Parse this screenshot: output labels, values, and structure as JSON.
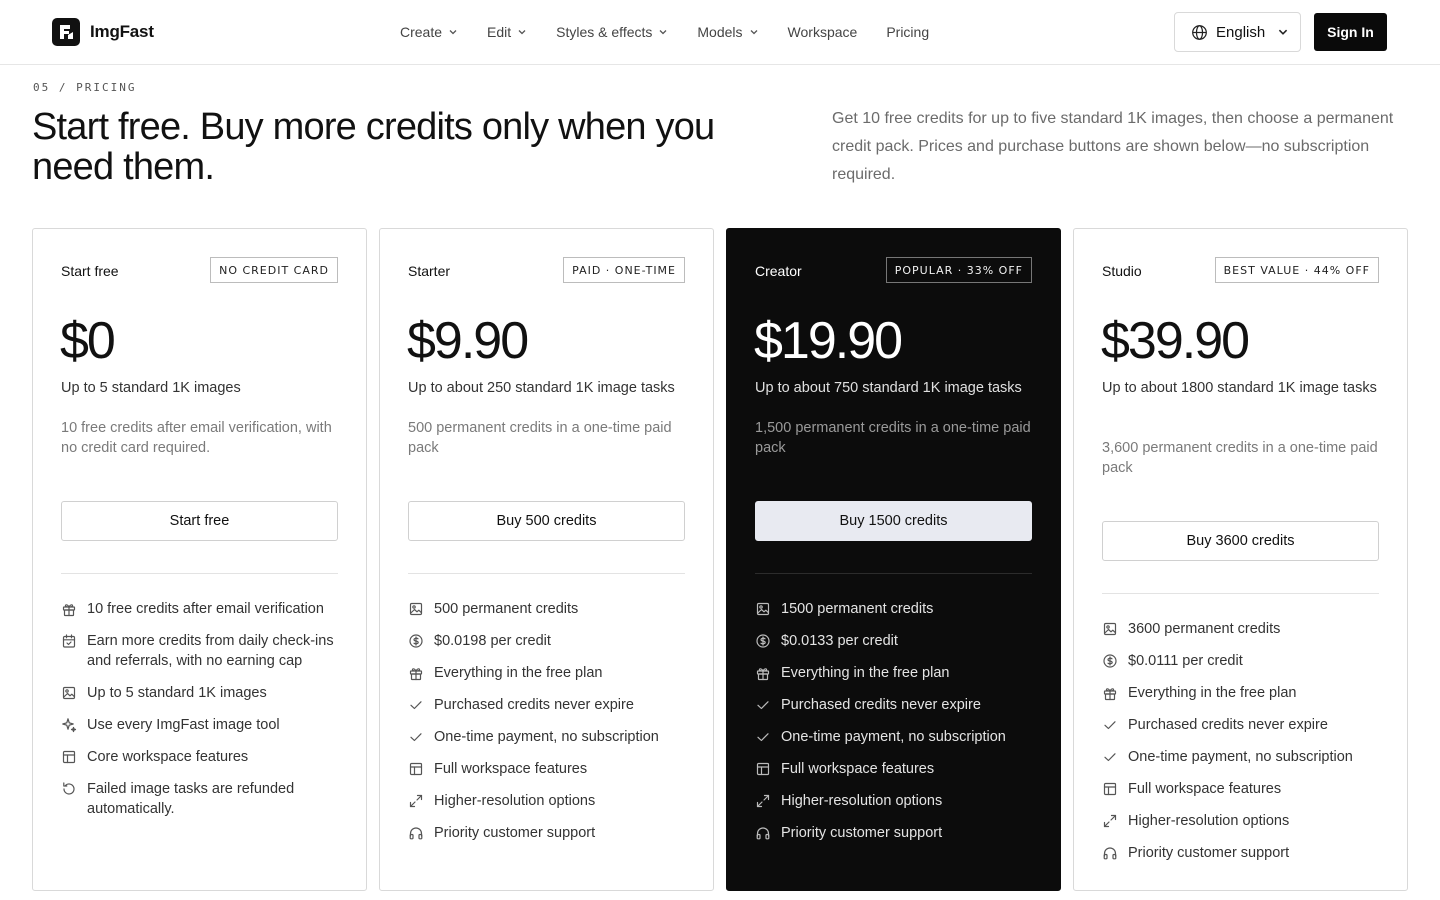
{
  "brand": {
    "name": "ImgFast"
  },
  "nav": [
    {
      "label": "Create",
      "dropdown": true,
      "icon": "chevron-down-icon"
    },
    {
      "label": "Edit",
      "dropdown": true,
      "icon": "chevron-down-icon"
    },
    {
      "label": "Styles & effects",
      "dropdown": true,
      "icon": "chevron-down-icon"
    },
    {
      "label": "Models",
      "dropdown": true,
      "icon": "chevron-down-icon"
    },
    {
      "label": "Workspace",
      "dropdown": false
    },
    {
      "label": "Pricing",
      "dropdown": false
    }
  ],
  "language": {
    "label": "English",
    "icon": "globe-icon"
  },
  "signin": {
    "label": "Sign In"
  },
  "hero": {
    "eyebrow": "05 / PRICING",
    "headline": "Start free. Buy more credits only when you need them.",
    "lede": "Get 10 free credits for up to five standard 1K images, then choose a permanent credit pack. Prices and purchase buttons are shown below—no subscription required."
  },
  "plans": [
    {
      "name": "Start free",
      "badge": "NO CREDIT CARD",
      "price": "$0",
      "summary": "Up to 5 standard 1K images",
      "description": "10 free credits after email verification, with no credit card required.",
      "cta": "Start free",
      "dark": false,
      "features": [
        {
          "icon": "gift-icon",
          "text": "10 free credits after email verification"
        },
        {
          "icon": "calendar-icon",
          "text": "Earn more credits from daily check-ins and referrals, with no earning cap"
        },
        {
          "icon": "image-icon",
          "text": "Up to 5 standard 1K images"
        },
        {
          "icon": "sparkles-icon",
          "text": "Use every ImgFast image tool"
        },
        {
          "icon": "layout-icon",
          "text": "Core workspace features"
        },
        {
          "icon": "refresh-icon",
          "text": "Failed image tasks are refunded automatically."
        }
      ]
    },
    {
      "name": "Starter",
      "badge": "PAID · ONE-TIME",
      "price": "$9.90",
      "summary": "Up to about 250 standard 1K image tasks",
      "description": "500 permanent credits in a one-time paid pack",
      "cta": "Buy 500 credits",
      "dark": false,
      "features": [
        {
          "icon": "image-icon",
          "text": "500 permanent credits"
        },
        {
          "icon": "dollar-icon",
          "text": "$0.0198 per credit"
        },
        {
          "icon": "gift-icon",
          "text": "Everything in the free plan"
        },
        {
          "icon": "check-icon",
          "text": "Purchased credits never expire"
        },
        {
          "icon": "check-icon",
          "text": "One-time payment, no subscription"
        },
        {
          "icon": "layout-icon",
          "text": "Full workspace features"
        },
        {
          "icon": "expand-icon",
          "text": "Higher-resolution options"
        },
        {
          "icon": "headphones-icon",
          "text": "Priority customer support"
        }
      ]
    },
    {
      "name": "Creator",
      "badge": "POPULAR · 33% OFF",
      "price": "$19.90",
      "summary": "Up to about 750 standard 1K image tasks",
      "description": "1,500 permanent credits in a one-time paid pack",
      "cta": "Buy 1500 credits",
      "dark": true,
      "features": [
        {
          "icon": "image-icon",
          "text": "1500 permanent credits"
        },
        {
          "icon": "dollar-icon",
          "text": "$0.0133 per credit"
        },
        {
          "icon": "gift-icon",
          "text": "Everything in the free plan"
        },
        {
          "icon": "check-icon",
          "text": "Purchased credits never expire"
        },
        {
          "icon": "check-icon",
          "text": "One-time payment, no subscription"
        },
        {
          "icon": "layout-icon",
          "text": "Full workspace features"
        },
        {
          "icon": "expand-icon",
          "text": "Higher-resolution options"
        },
        {
          "icon": "headphones-icon",
          "text": "Priority customer support"
        }
      ]
    },
    {
      "name": "Studio",
      "badge": "BEST VALUE · 44% OFF",
      "price": "$39.90",
      "summary": "Up to about 1800 standard 1K image tasks",
      "description": "3,600 permanent credits in a one-time paid pack",
      "cta": "Buy 3600 credits",
      "dark": false,
      "features": [
        {
          "icon": "image-icon",
          "text": "3600 permanent credits"
        },
        {
          "icon": "dollar-icon",
          "text": "$0.0111 per credit"
        },
        {
          "icon": "gift-icon",
          "text": "Everything in the free plan"
        },
        {
          "icon": "check-icon",
          "text": "Purchased credits never expire"
        },
        {
          "icon": "check-icon",
          "text": "One-time payment, no subscription"
        },
        {
          "icon": "layout-icon",
          "text": "Full workspace features"
        },
        {
          "icon": "expand-icon",
          "text": "Higher-resolution options"
        },
        {
          "icon": "headphones-icon",
          "text": "Priority customer support"
        }
      ]
    }
  ]
}
